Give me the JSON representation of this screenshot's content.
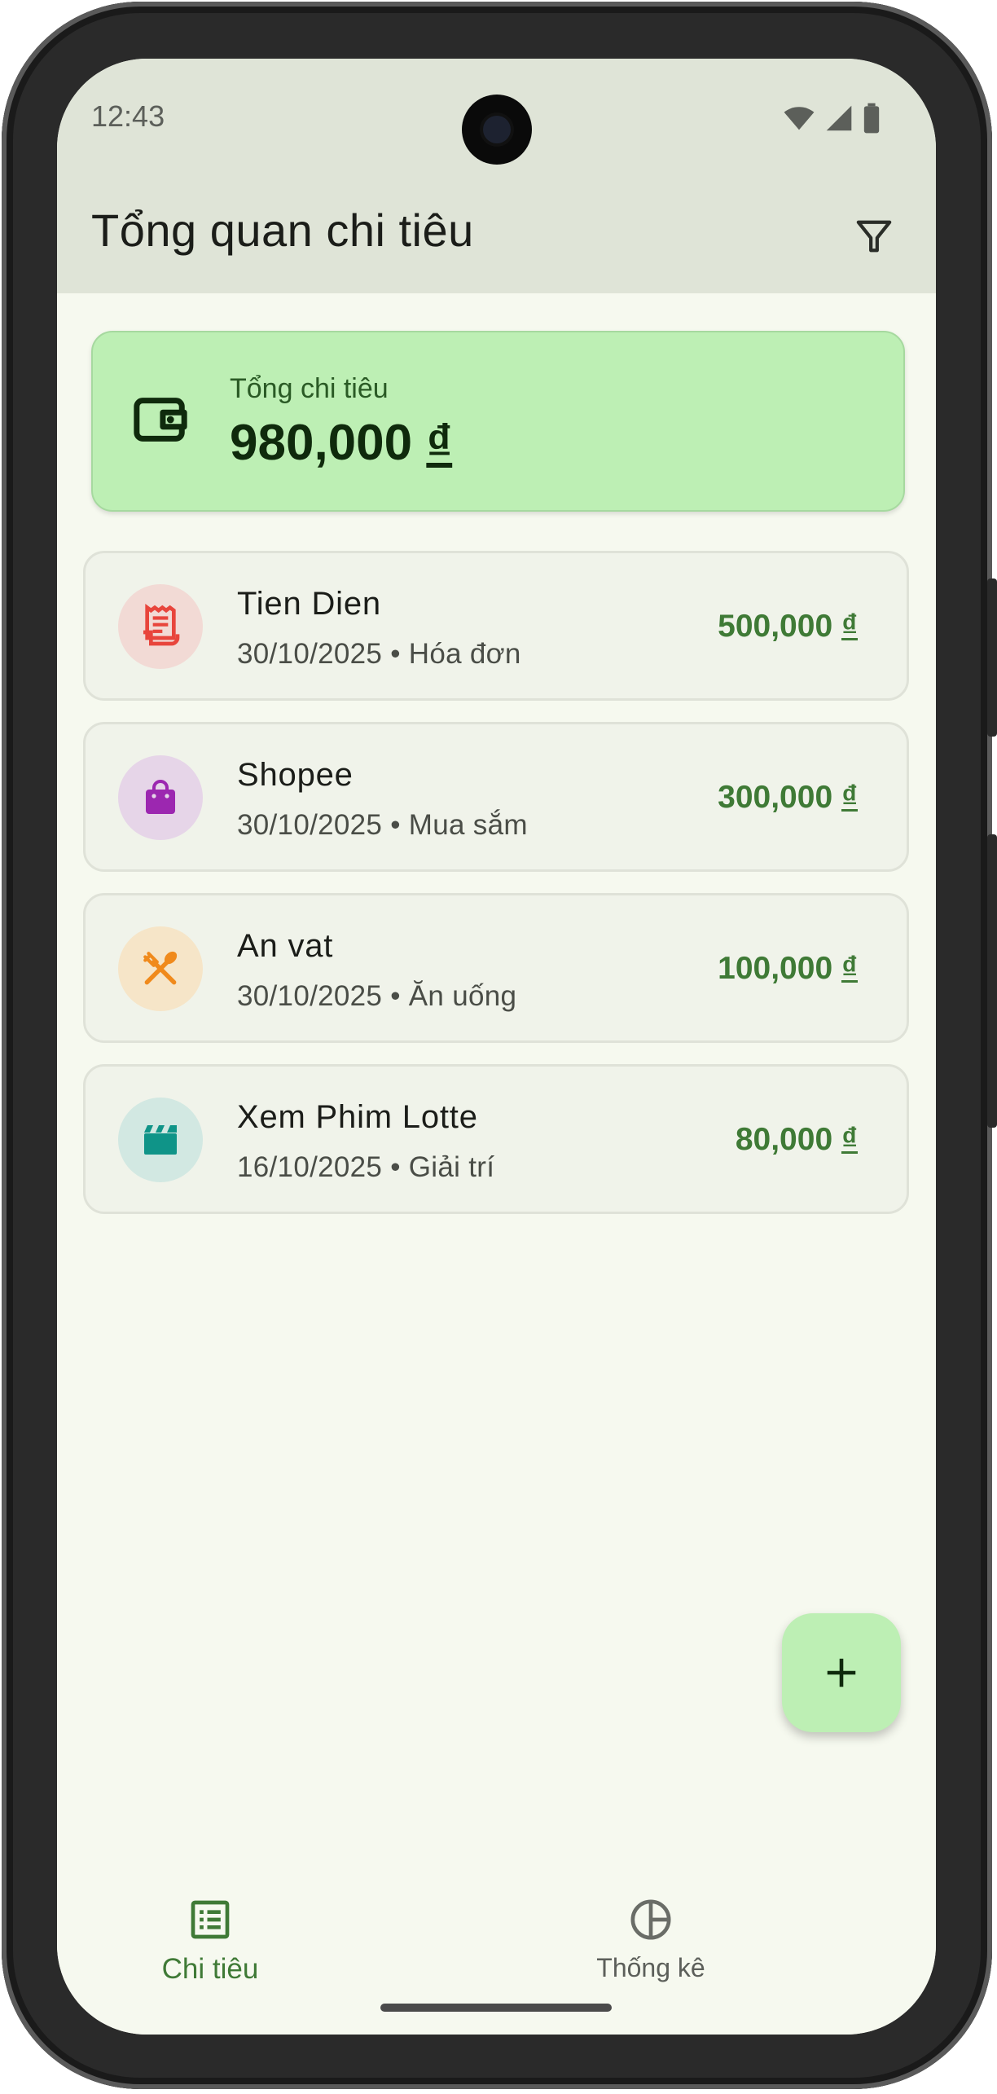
{
  "status_bar": {
    "time": "12:43"
  },
  "app_bar": {
    "title": "Tổng quan chi tiêu",
    "filter_icon": "filter-icon"
  },
  "summary": {
    "label": "Tổng chi tiêu",
    "amount": "980,000",
    "currency": "₫",
    "icon": "wallet-icon"
  },
  "transactions": [
    {
      "name": "Tien Dien",
      "meta": "30/10/2025 • Hóa đơn",
      "amount": "500,000",
      "currency": "₫",
      "icon": "receipt-icon",
      "icon_color": "#e8453c",
      "icon_bg": "#f2dad5"
    },
    {
      "name": "Shopee",
      "meta": "30/10/2025 • Mua sắm",
      "amount": "300,000",
      "currency": "₫",
      "icon": "shopping-bag-icon",
      "icon_color": "#9c27b0",
      "icon_bg": "#e6d5e8"
    },
    {
      "name": "An vat",
      "meta": "30/10/2025 • Ăn uống",
      "amount": "100,000",
      "currency": "₫",
      "icon": "restaurant-icon",
      "icon_color": "#f08a1c",
      "icon_bg": "#f6e5c8"
    },
    {
      "name": "Xem Phim Lotte",
      "meta": "16/10/2025 • Giải trí",
      "amount": "80,000",
      "currency": "₫",
      "icon": "movie-icon",
      "icon_color": "#0f9488",
      "icon_bg": "#d2e8e2"
    }
  ],
  "fab": {
    "icon": "add-icon"
  },
  "bottom_nav": [
    {
      "label": "Chi tiêu",
      "icon": "list-icon",
      "active": true
    },
    {
      "label": "Thống kê",
      "icon": "pie-chart-icon",
      "active": false
    }
  ],
  "colors": {
    "accent": "#3f7a36",
    "summary_bg": "#bdefb4",
    "topbar_bg": "#dfe4d7",
    "screen_bg": "#f6f9ef"
  }
}
